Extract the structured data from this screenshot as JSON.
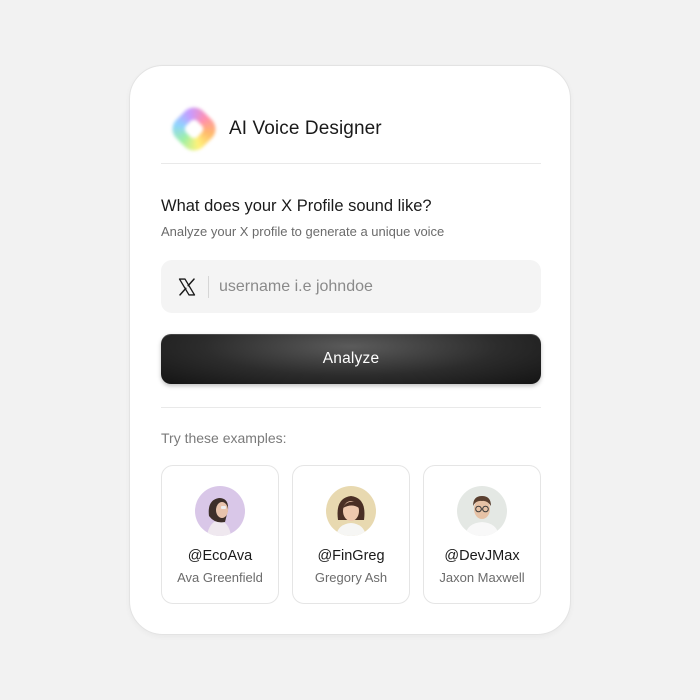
{
  "app": {
    "title": "AI Voice Designer"
  },
  "form": {
    "heading": "What does your X Profile sound like?",
    "subheading": "Analyze your X profile to generate a unique voice",
    "input_placeholder": "username i.e johndoe",
    "input_value": "",
    "input_icon": "x-logo-icon",
    "submit_label": "Analyze"
  },
  "examples": {
    "label": "Try these examples:",
    "items": [
      {
        "handle": "@EcoAva",
        "name": "Ava Greenfield",
        "avatar_bg": "#d9c7e8"
      },
      {
        "handle": "@FinGreg",
        "name": "Gregory Ash",
        "avatar_bg": "#e8d9b0"
      },
      {
        "handle": "@DevJMax",
        "name": "Jaxon Maxwell",
        "avatar_bg": "#e4e8e4"
      }
    ]
  },
  "colors": {
    "background": "#f2f2f2",
    "card": "#ffffff",
    "button": "#1c1c1c",
    "input_bg": "#f4f4f4"
  }
}
